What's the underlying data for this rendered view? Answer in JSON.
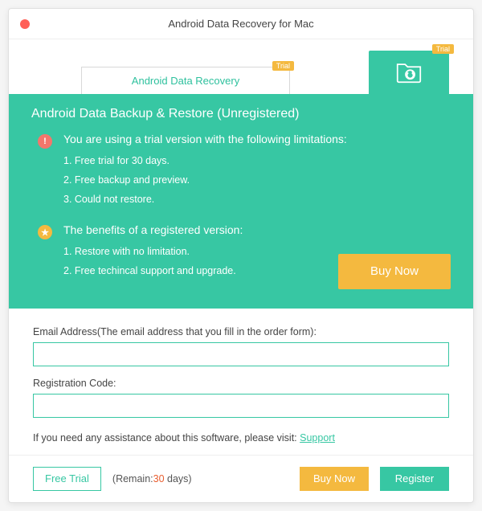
{
  "window": {
    "title": "Android Data Recovery for Mac"
  },
  "tabs": {
    "recovery": {
      "label": "Android Data Recovery",
      "badge": "Trial"
    },
    "backup": {
      "badge": "Trial"
    }
  },
  "panel": {
    "title": "Android Data Backup & Restore (Unregistered)",
    "limitations": {
      "heading": "You are using a trial version with the following limitations:",
      "item1": "1. Free trial for 30 days.",
      "item2": "2. Free backup and preview.",
      "item3": "3. Could not restore."
    },
    "benefits": {
      "heading": "The benefits of a registered version:",
      "item1": "1. Restore with no limitation.",
      "item2": "2. Free techincal support and upgrade."
    },
    "buy_now": "Buy Now"
  },
  "form": {
    "email_label": "Email Address(The email address that you fill in the order form):",
    "email_value": "",
    "code_label": "Registration Code:",
    "code_value": "",
    "assist_text": "If you need any assistance about this software, please visit: ",
    "support_link": "Support"
  },
  "footer": {
    "free_trial": "Free Trial",
    "remain_prefix": "(Remain:",
    "remain_days": "30",
    "remain_suffix": " days)",
    "buy_now": "Buy Now",
    "register": "Register"
  }
}
